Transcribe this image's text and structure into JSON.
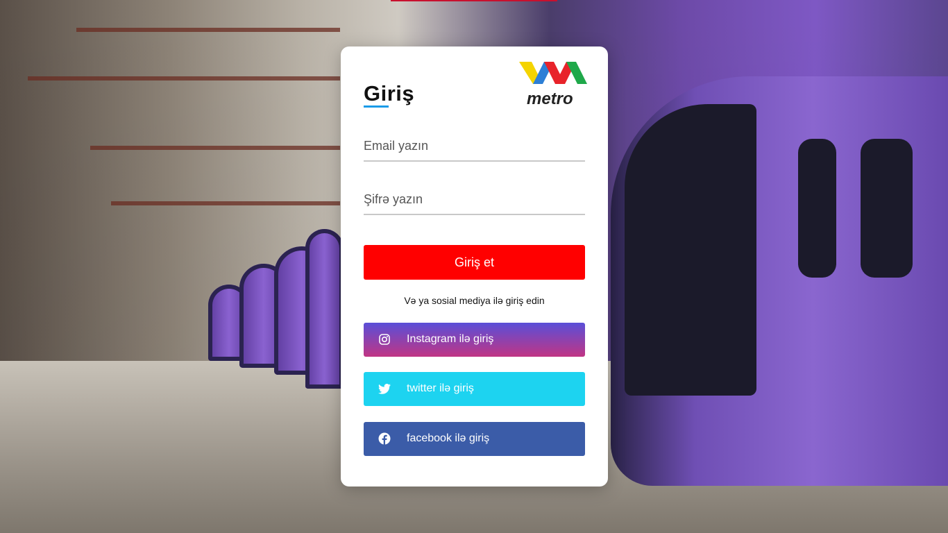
{
  "login": {
    "title": "Giriş",
    "logo_text": "metro",
    "email_placeholder": "Email yazın",
    "password_placeholder": "Şifrə yazın",
    "submit_label": "Giriş et",
    "social_prompt": "Və ya sosial mediya ilə giriş edin",
    "social": {
      "instagram": "Instagram ilə giriş",
      "twitter": "twitter ilə giriş",
      "facebook": "facebook ilə giriş"
    }
  },
  "colors": {
    "submit": "#ff0000",
    "twitter": "#1dd3f0",
    "facebook": "#3b5ca8",
    "accent_underline": "#1a9be8"
  },
  "icons": {
    "instagram": "instagram-icon",
    "twitter": "twitter-icon",
    "facebook": "facebook-icon",
    "logo": "metro-logo"
  }
}
